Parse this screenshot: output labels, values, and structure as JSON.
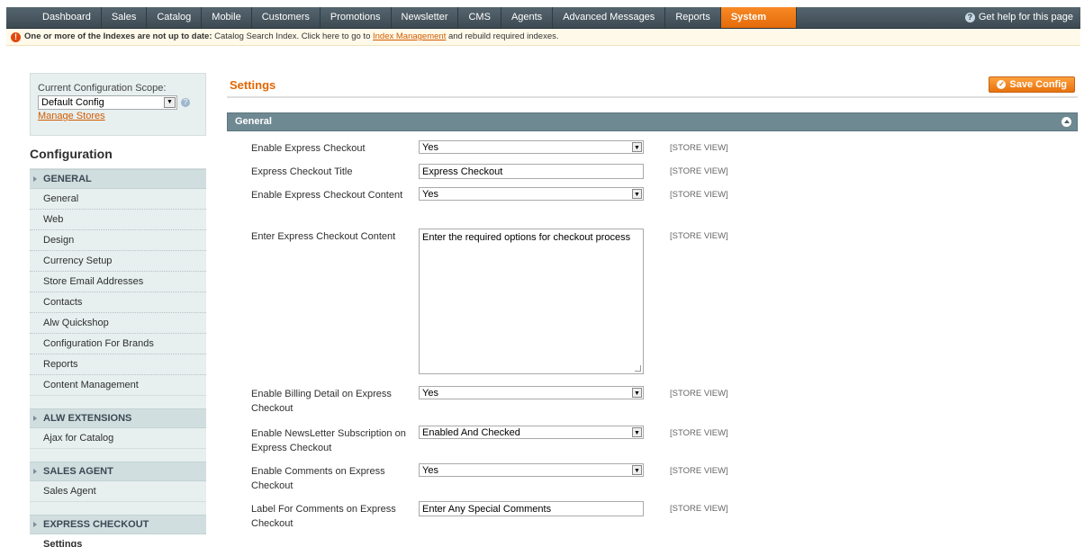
{
  "nav": {
    "items": [
      "Dashboard",
      "Sales",
      "Catalog",
      "Mobile",
      "Customers",
      "Promotions",
      "Newsletter",
      "CMS",
      "Agents",
      "Advanced Messages",
      "Reports",
      "System"
    ],
    "active": "System",
    "help": "Get help for this page"
  },
  "notice": {
    "bold": "One or more of the Indexes are not up to date:",
    "text": "Catalog Search Index. Click here to go to",
    "link": "Index Management",
    "tail": "and rebuild required indexes."
  },
  "scope": {
    "label": "Current Configuration Scope:",
    "value": "Default Config",
    "manage": "Manage Stores"
  },
  "sidebar": {
    "title": "Configuration",
    "sections": [
      {
        "head": "GENERAL",
        "items": [
          "General",
          "Web",
          "Design",
          "Currency Setup",
          "Store Email Addresses",
          "Contacts",
          "Alw Quickshop",
          "Configuration For Brands",
          "Reports",
          "Content Management"
        ]
      },
      {
        "head": "ALW EXTENSIONS",
        "items": [
          "Ajax for Catalog"
        ]
      },
      {
        "head": "SALES AGENT",
        "items": [
          "Sales Agent"
        ]
      },
      {
        "head": "EXPRESS CHECKOUT",
        "items": [
          "Settings"
        ]
      }
    ]
  },
  "main": {
    "title": "Settings",
    "save": "Save Config",
    "group": "General",
    "store_view": "[STORE VIEW]",
    "fields": {
      "f1": {
        "label": "Enable Express Checkout",
        "value": "Yes"
      },
      "f2": {
        "label": "Express Checkout Title",
        "value": "Express Checkout"
      },
      "f3": {
        "label": "Enable Express Checkout Content",
        "value": "Yes"
      },
      "f4": {
        "label": "Enter Express Checkout Content",
        "value": "Enter the required options for checkout process"
      },
      "f5": {
        "label": "Enable Billing Detail on Express Checkout",
        "value": "Yes"
      },
      "f6": {
        "label": "Enable NewsLetter Subscription on Express Checkout",
        "value": "Enabled And Checked"
      },
      "f7": {
        "label": "Enable Comments on Express Checkout",
        "value": "Yes"
      },
      "f8": {
        "label": "Label For Comments on Express Checkout",
        "value": "Enter Any Special Comments"
      }
    }
  }
}
